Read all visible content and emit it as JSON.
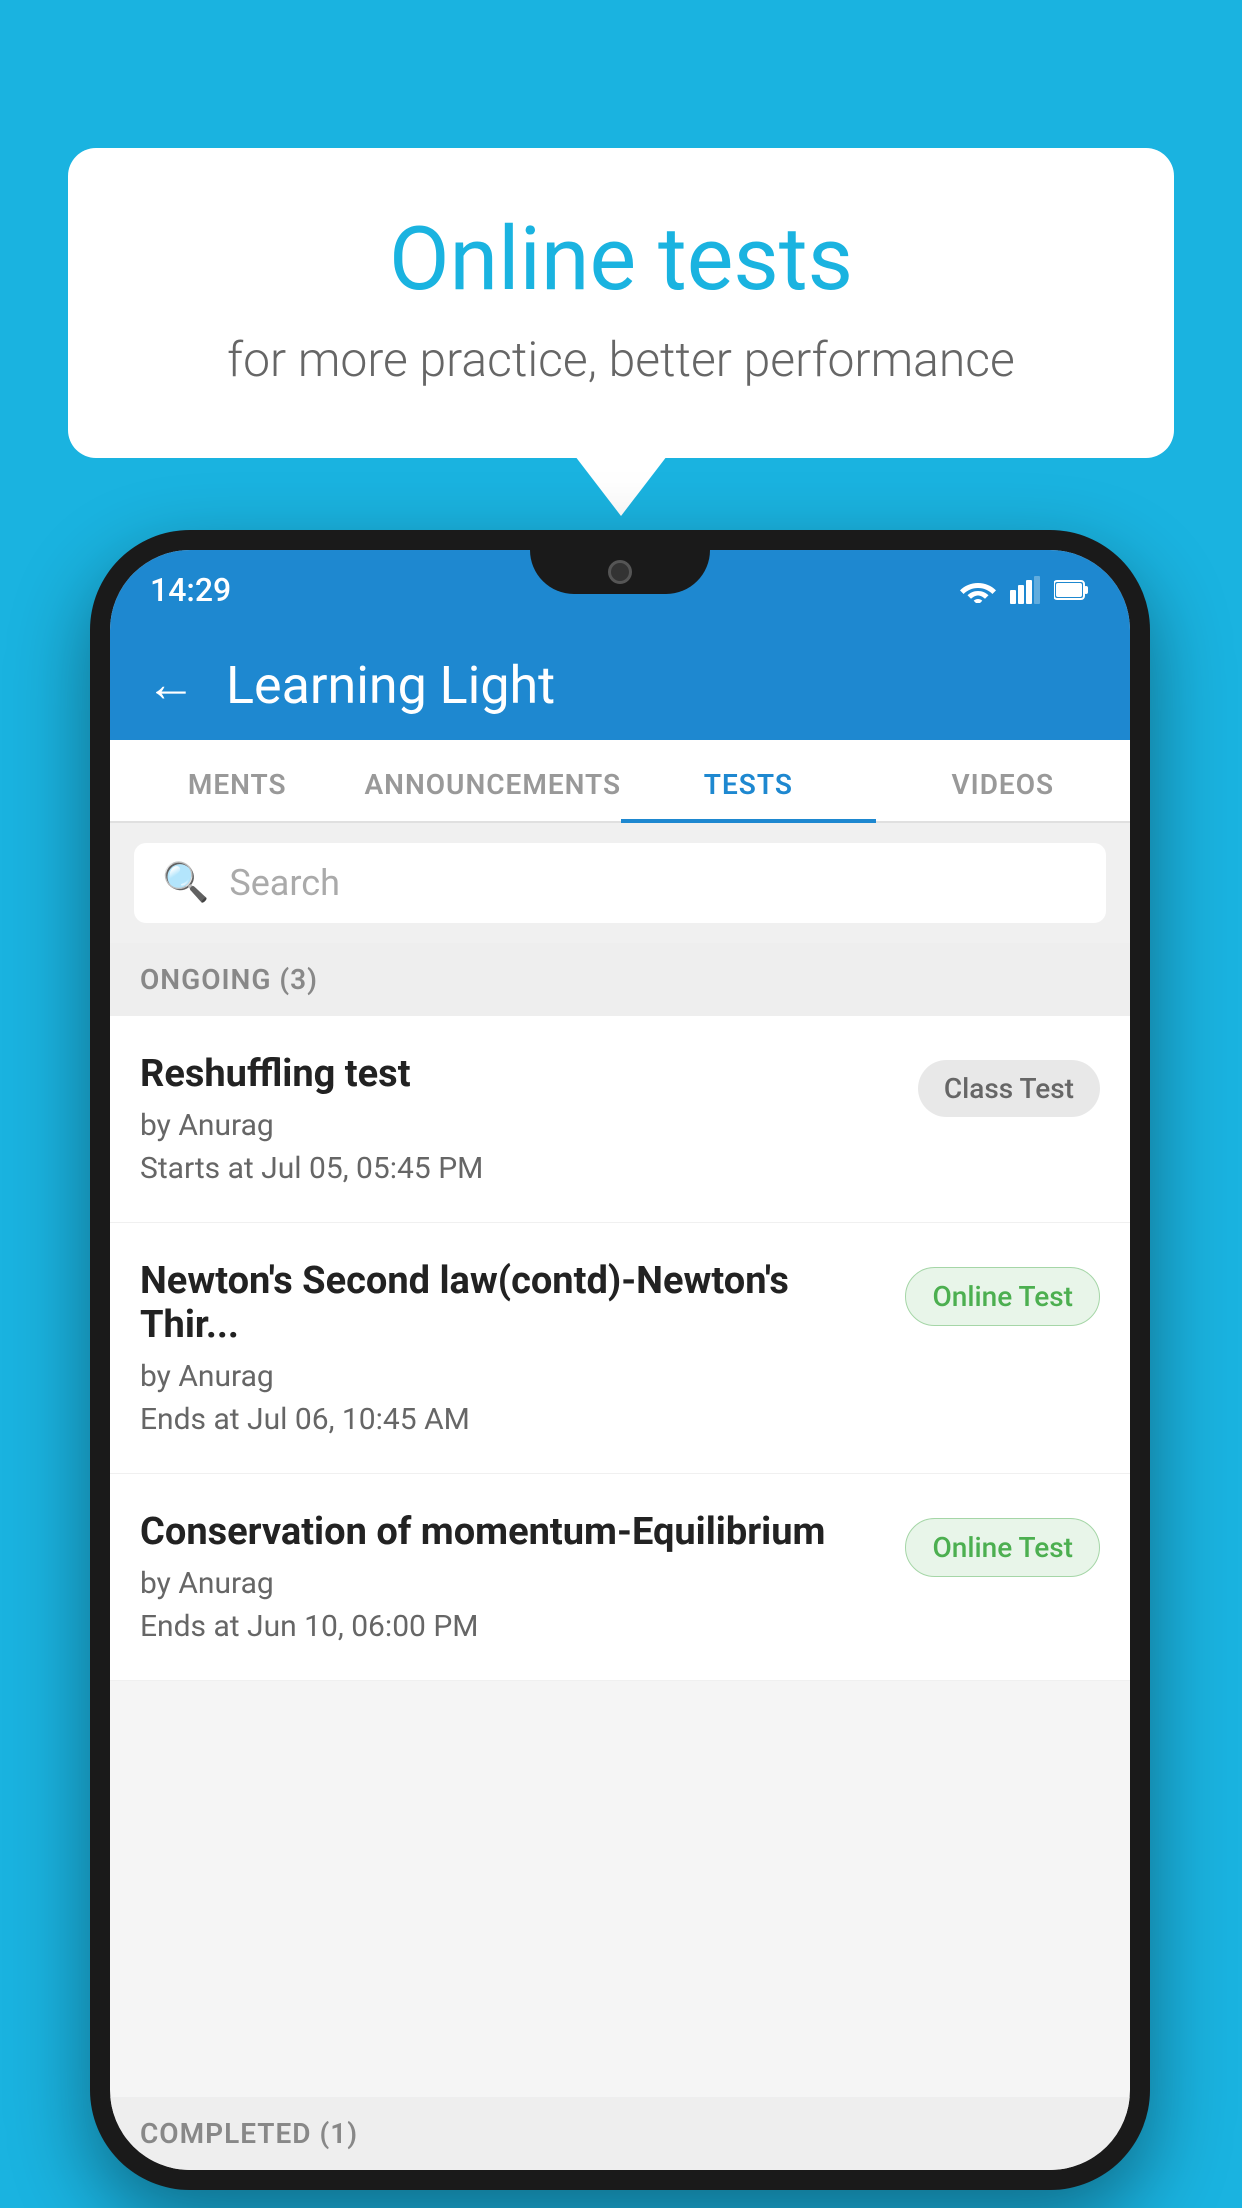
{
  "background": {
    "color": "#1ab3e0"
  },
  "speech_bubble": {
    "title": "Online tests",
    "subtitle": "for more practice, better performance"
  },
  "phone": {
    "status_bar": {
      "time": "14:29",
      "wifi_icon": "wifi-icon",
      "signal_icon": "signal-icon",
      "battery_icon": "battery-icon"
    },
    "app_header": {
      "back_label": "←",
      "title": "Learning Light"
    },
    "tabs": [
      {
        "label": "MENTS",
        "active": false
      },
      {
        "label": "ANNOUNCEMENTS",
        "active": false
      },
      {
        "label": "TESTS",
        "active": true
      },
      {
        "label": "VIDEOS",
        "active": false
      }
    ],
    "search": {
      "placeholder": "Search"
    },
    "ongoing_section": {
      "label": "ONGOING (3)"
    },
    "test_items": [
      {
        "name": "Reshuffling test",
        "author": "by Anurag",
        "date": "Starts at  Jul 05, 05:45 PM",
        "badge": "Class Test",
        "badge_type": "class"
      },
      {
        "name": "Newton's Second law(contd)-Newton's Thir...",
        "author": "by Anurag",
        "date": "Ends at  Jul 06, 10:45 AM",
        "badge": "Online Test",
        "badge_type": "online"
      },
      {
        "name": "Conservation of momentum-Equilibrium",
        "author": "by Anurag",
        "date": "Ends at  Jun 10, 06:00 PM",
        "badge": "Online Test",
        "badge_type": "online"
      }
    ],
    "completed_section": {
      "label": "COMPLETED (1)"
    }
  }
}
